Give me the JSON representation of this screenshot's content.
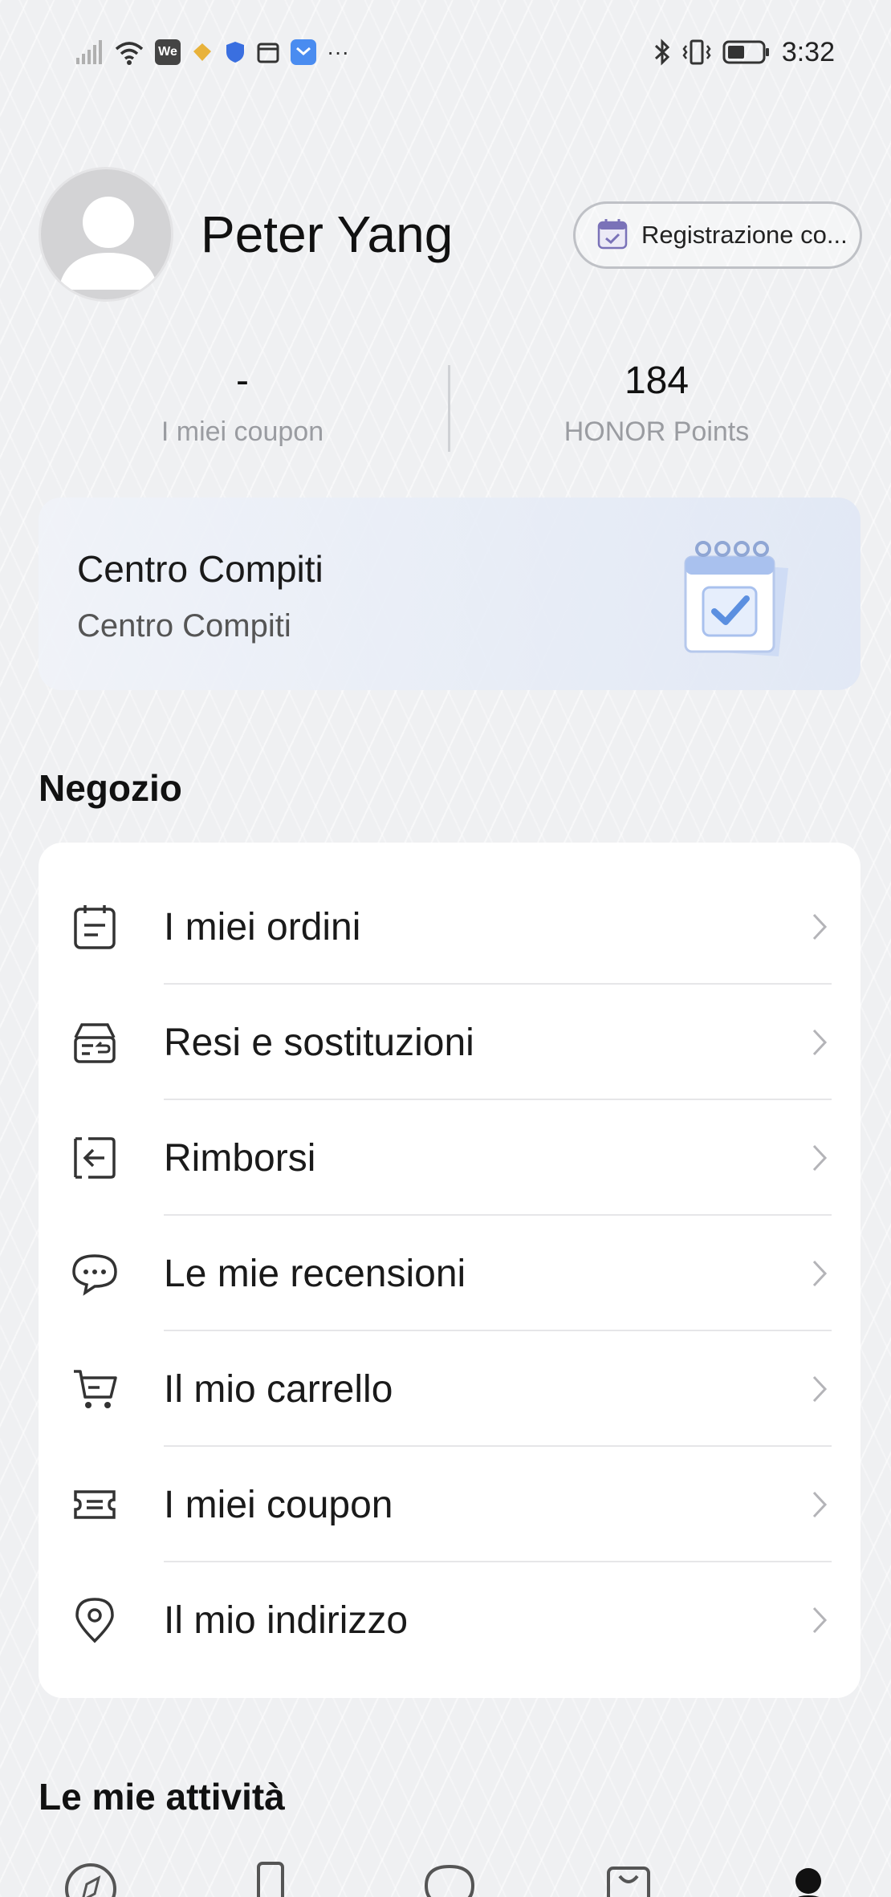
{
  "status_bar": {
    "time": "3:32",
    "left_icons": [
      "signal-icon",
      "wifi-icon",
      "we-app-icon",
      "diamond-app-icon",
      "shield-app-icon",
      "calendar-app-icon",
      "shop-app-icon",
      "more-notifications-icon"
    ],
    "we_label": "We",
    "more_label": "···",
    "right_icons": [
      "bluetooth-icon",
      "vibrate-icon",
      "battery-icon"
    ]
  },
  "profile": {
    "name": "Peter Yang",
    "checkin_label": "Registrazione co..."
  },
  "stats": [
    {
      "value": "-",
      "label": "I miei coupon"
    },
    {
      "value": "184",
      "label": "HONOR Points"
    }
  ],
  "task_center": {
    "title": "Centro Compiti",
    "subtitle": "Centro Compiti"
  },
  "shop_section": {
    "title": "Negozio",
    "items": [
      {
        "label": "I miei ordini",
        "icon": "orders-icon"
      },
      {
        "label": "Resi e sostituzioni",
        "icon": "returns-icon"
      },
      {
        "label": "Rimborsi",
        "icon": "refund-icon"
      },
      {
        "label": "Le mie recensioni",
        "icon": "reviews-icon"
      },
      {
        "label": "Il mio carrello",
        "icon": "cart-icon"
      },
      {
        "label": "I miei coupon",
        "icon": "coupon-icon"
      },
      {
        "label": "Il mio indirizzo",
        "icon": "location-pin-icon"
      }
    ]
  },
  "activities_section": {
    "title": "Le mie attività"
  },
  "bottom_nav": {
    "items": [
      "compass-icon",
      "phone-icon",
      "chat-icon",
      "shopping-bag-icon",
      "profile-icon"
    ],
    "active": "profile-icon"
  }
}
